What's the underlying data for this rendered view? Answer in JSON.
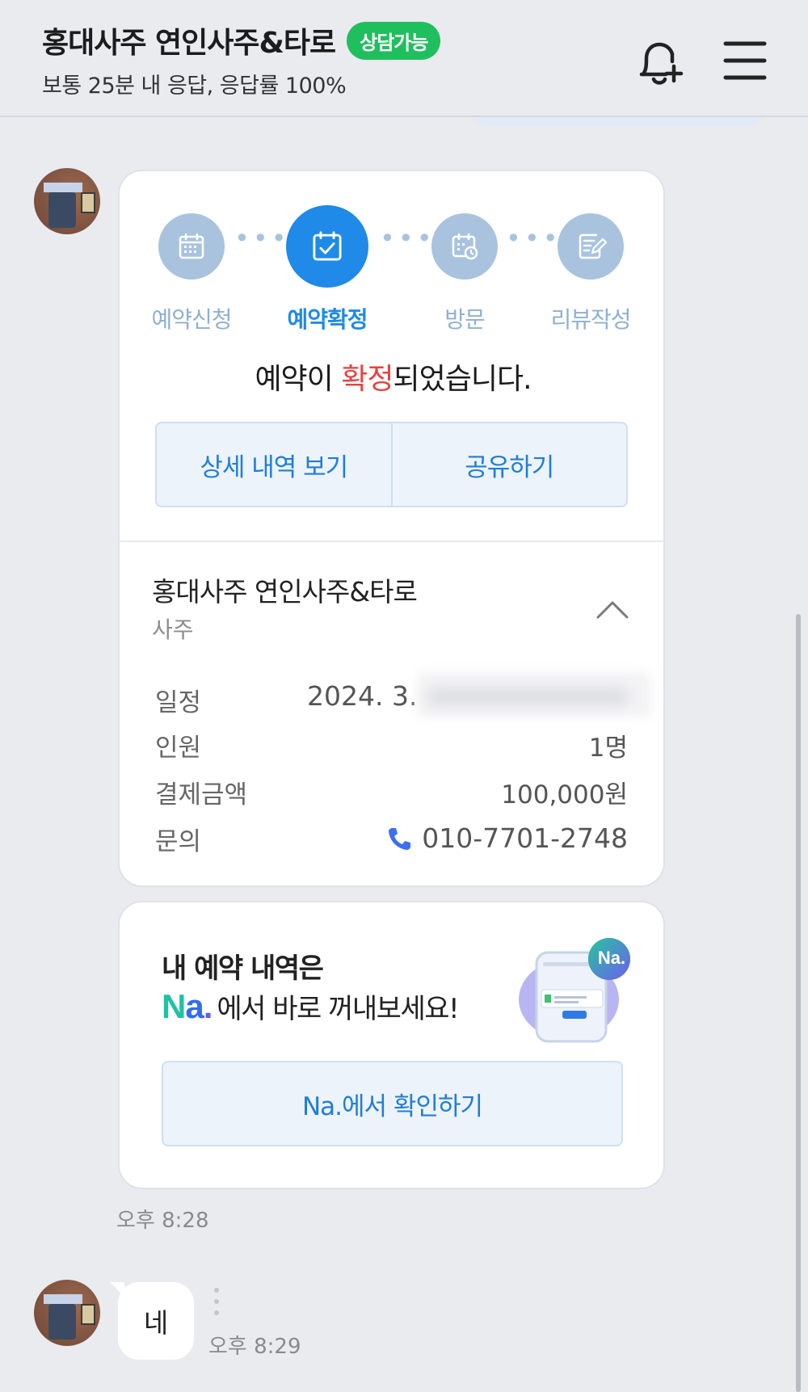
{
  "header": {
    "title": "홍대사주 연인사주&타로",
    "status_badge": "상담가능",
    "subtitle": "보통 25분 내 응답, 응답률 100%",
    "icons": [
      "bell-plus-icon",
      "hamburger-menu-icon"
    ]
  },
  "reservation": {
    "steps": [
      {
        "label": "예약신청",
        "icon": "calendar-grid-icon",
        "active": false
      },
      {
        "label": "예약확정",
        "icon": "calendar-check-icon",
        "active": true
      },
      {
        "label": "방문",
        "icon": "calendar-clock-icon",
        "active": false
      },
      {
        "label": "리뷰작성",
        "icon": "edit-note-icon",
        "active": false
      }
    ],
    "message_pre": "예약이 ",
    "message_hl": "확정",
    "message_post": "되었습니다.",
    "detail_button": "상세 내역 보기",
    "share_button": "공유하기",
    "shop_name": "홍대사주 연인사주&타로",
    "shop_category": "사주",
    "rows": {
      "date_label": "일정",
      "date_value": "2024. 3.",
      "people_label": "인원",
      "people_value": "1명",
      "amount_label": "결제금액",
      "amount_value": "100,000원",
      "contact_label": "문의",
      "contact_value": "010-7701-2748"
    },
    "accent_color": "#1f8ae8",
    "highlight_color": "#e8413c"
  },
  "promo": {
    "line1": "내 예약 내역은",
    "logo_n": "N",
    "logo_a": "a",
    "logo_dot": ".",
    "line2": "에서 바로 꺼내보세요!",
    "badge": "Na.",
    "button": "Na.에서 확인하기"
  },
  "messages": {
    "time1": "오후 8:28",
    "reply_text": "네",
    "time2": "오후 8:29"
  }
}
